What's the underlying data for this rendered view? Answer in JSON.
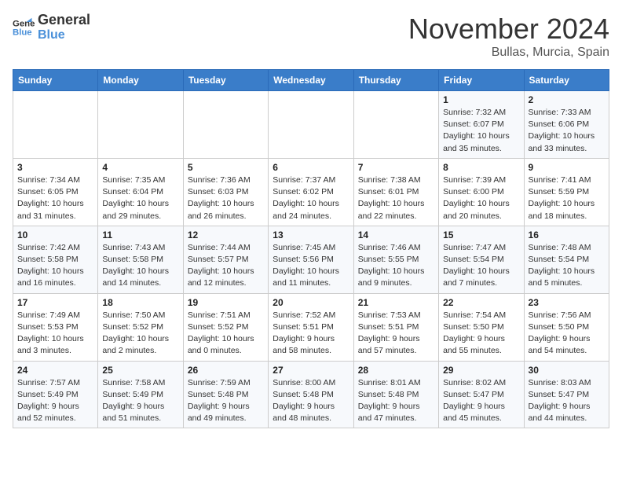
{
  "header": {
    "logo_line1": "General",
    "logo_line2": "Blue",
    "month": "November 2024",
    "location": "Bullas, Murcia, Spain"
  },
  "weekdays": [
    "Sunday",
    "Monday",
    "Tuesday",
    "Wednesday",
    "Thursday",
    "Friday",
    "Saturday"
  ],
  "weeks": [
    [
      {
        "day": "",
        "info": ""
      },
      {
        "day": "",
        "info": ""
      },
      {
        "day": "",
        "info": ""
      },
      {
        "day": "",
        "info": ""
      },
      {
        "day": "",
        "info": ""
      },
      {
        "day": "1",
        "info": "Sunrise: 7:32 AM\nSunset: 6:07 PM\nDaylight: 10 hours and 35 minutes."
      },
      {
        "day": "2",
        "info": "Sunrise: 7:33 AM\nSunset: 6:06 PM\nDaylight: 10 hours and 33 minutes."
      }
    ],
    [
      {
        "day": "3",
        "info": "Sunrise: 7:34 AM\nSunset: 6:05 PM\nDaylight: 10 hours and 31 minutes."
      },
      {
        "day": "4",
        "info": "Sunrise: 7:35 AM\nSunset: 6:04 PM\nDaylight: 10 hours and 29 minutes."
      },
      {
        "day": "5",
        "info": "Sunrise: 7:36 AM\nSunset: 6:03 PM\nDaylight: 10 hours and 26 minutes."
      },
      {
        "day": "6",
        "info": "Sunrise: 7:37 AM\nSunset: 6:02 PM\nDaylight: 10 hours and 24 minutes."
      },
      {
        "day": "7",
        "info": "Sunrise: 7:38 AM\nSunset: 6:01 PM\nDaylight: 10 hours and 22 minutes."
      },
      {
        "day": "8",
        "info": "Sunrise: 7:39 AM\nSunset: 6:00 PM\nDaylight: 10 hours and 20 minutes."
      },
      {
        "day": "9",
        "info": "Sunrise: 7:41 AM\nSunset: 5:59 PM\nDaylight: 10 hours and 18 minutes."
      }
    ],
    [
      {
        "day": "10",
        "info": "Sunrise: 7:42 AM\nSunset: 5:58 PM\nDaylight: 10 hours and 16 minutes."
      },
      {
        "day": "11",
        "info": "Sunrise: 7:43 AM\nSunset: 5:58 PM\nDaylight: 10 hours and 14 minutes."
      },
      {
        "day": "12",
        "info": "Sunrise: 7:44 AM\nSunset: 5:57 PM\nDaylight: 10 hours and 12 minutes."
      },
      {
        "day": "13",
        "info": "Sunrise: 7:45 AM\nSunset: 5:56 PM\nDaylight: 10 hours and 11 minutes."
      },
      {
        "day": "14",
        "info": "Sunrise: 7:46 AM\nSunset: 5:55 PM\nDaylight: 10 hours and 9 minutes."
      },
      {
        "day": "15",
        "info": "Sunrise: 7:47 AM\nSunset: 5:54 PM\nDaylight: 10 hours and 7 minutes."
      },
      {
        "day": "16",
        "info": "Sunrise: 7:48 AM\nSunset: 5:54 PM\nDaylight: 10 hours and 5 minutes."
      }
    ],
    [
      {
        "day": "17",
        "info": "Sunrise: 7:49 AM\nSunset: 5:53 PM\nDaylight: 10 hours and 3 minutes."
      },
      {
        "day": "18",
        "info": "Sunrise: 7:50 AM\nSunset: 5:52 PM\nDaylight: 10 hours and 2 minutes."
      },
      {
        "day": "19",
        "info": "Sunrise: 7:51 AM\nSunset: 5:52 PM\nDaylight: 10 hours and 0 minutes."
      },
      {
        "day": "20",
        "info": "Sunrise: 7:52 AM\nSunset: 5:51 PM\nDaylight: 9 hours and 58 minutes."
      },
      {
        "day": "21",
        "info": "Sunrise: 7:53 AM\nSunset: 5:51 PM\nDaylight: 9 hours and 57 minutes."
      },
      {
        "day": "22",
        "info": "Sunrise: 7:54 AM\nSunset: 5:50 PM\nDaylight: 9 hours and 55 minutes."
      },
      {
        "day": "23",
        "info": "Sunrise: 7:56 AM\nSunset: 5:50 PM\nDaylight: 9 hours and 54 minutes."
      }
    ],
    [
      {
        "day": "24",
        "info": "Sunrise: 7:57 AM\nSunset: 5:49 PM\nDaylight: 9 hours and 52 minutes."
      },
      {
        "day": "25",
        "info": "Sunrise: 7:58 AM\nSunset: 5:49 PM\nDaylight: 9 hours and 51 minutes."
      },
      {
        "day": "26",
        "info": "Sunrise: 7:59 AM\nSunset: 5:48 PM\nDaylight: 9 hours and 49 minutes."
      },
      {
        "day": "27",
        "info": "Sunrise: 8:00 AM\nSunset: 5:48 PM\nDaylight: 9 hours and 48 minutes."
      },
      {
        "day": "28",
        "info": "Sunrise: 8:01 AM\nSunset: 5:48 PM\nDaylight: 9 hours and 47 minutes."
      },
      {
        "day": "29",
        "info": "Sunrise: 8:02 AM\nSunset: 5:47 PM\nDaylight: 9 hours and 45 minutes."
      },
      {
        "day": "30",
        "info": "Sunrise: 8:03 AM\nSunset: 5:47 PM\nDaylight: 9 hours and 44 minutes."
      }
    ]
  ]
}
